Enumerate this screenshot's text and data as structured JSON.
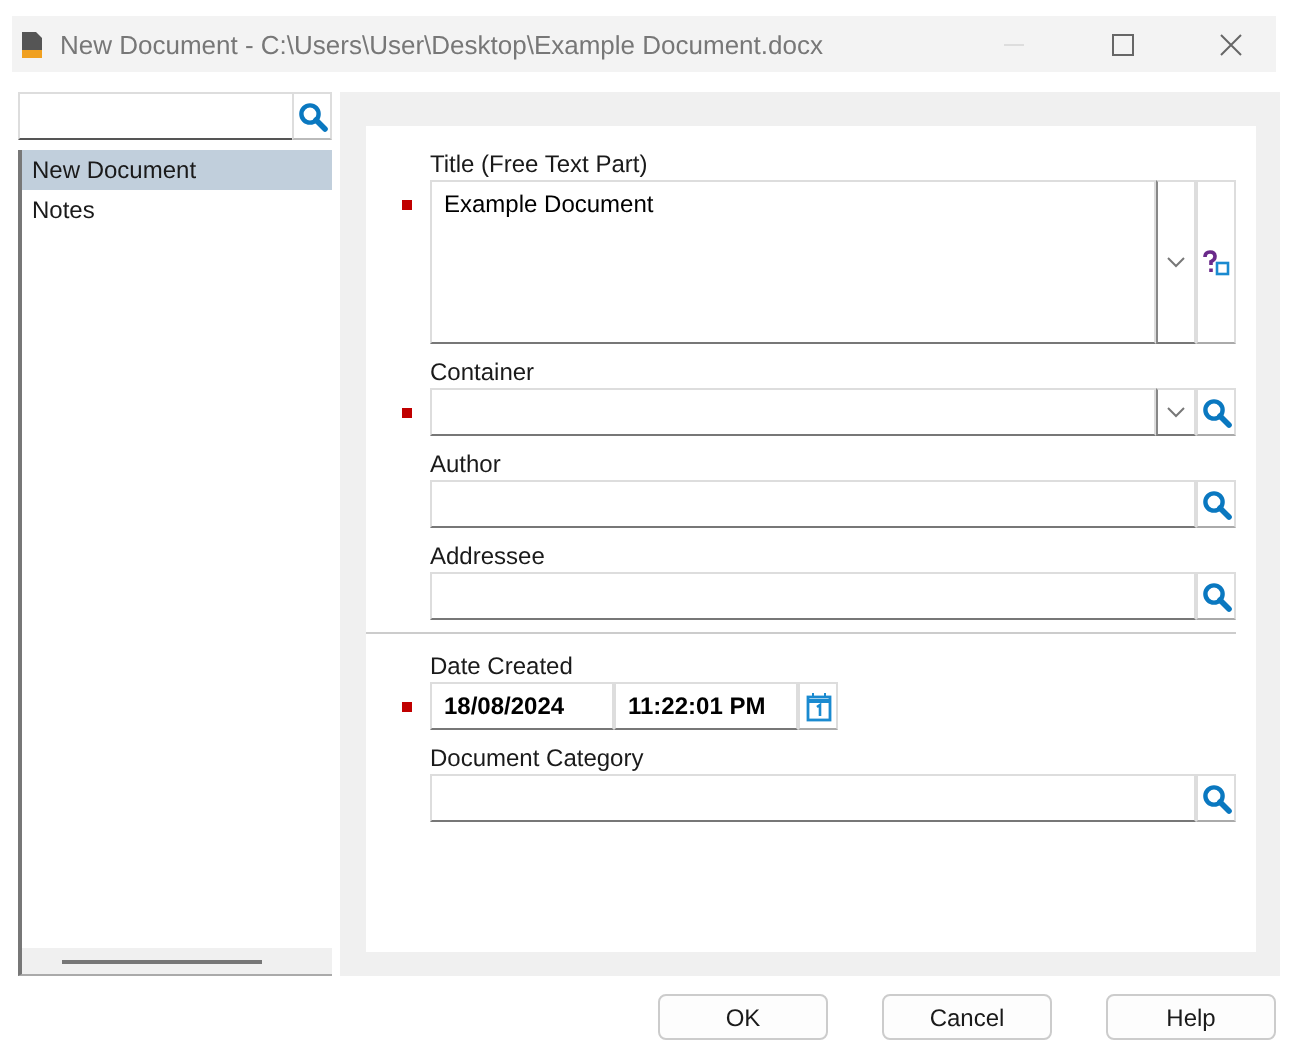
{
  "window": {
    "title": "New Document - C:\\Users\\User\\Desktop\\Example Document.docx"
  },
  "sidebar": {
    "items": [
      {
        "label": "New Document",
        "selected": true
      },
      {
        "label": "Notes",
        "selected": false
      }
    ]
  },
  "sections": [
    {
      "fields": [
        {
          "kind": "textarea",
          "label": "Title (Free Text Part)",
          "required": true,
          "value": "Example Document"
        },
        {
          "kind": "combo_lookup",
          "label": "Container",
          "required": true
        },
        {
          "kind": "lookup",
          "label": "Author",
          "required": false
        },
        {
          "kind": "lookup",
          "label": "Addressee",
          "required": false
        }
      ]
    },
    {
      "fields": [
        {
          "kind": "datetime",
          "label": "Date Created",
          "required": true,
          "date": "18/08/2024",
          "time": "11:22:01 PM"
        },
        {
          "kind": "lookup",
          "label": "Document Category",
          "required": false
        }
      ]
    }
  ],
  "buttons": [
    "OK",
    "Cancel",
    "Help"
  ]
}
